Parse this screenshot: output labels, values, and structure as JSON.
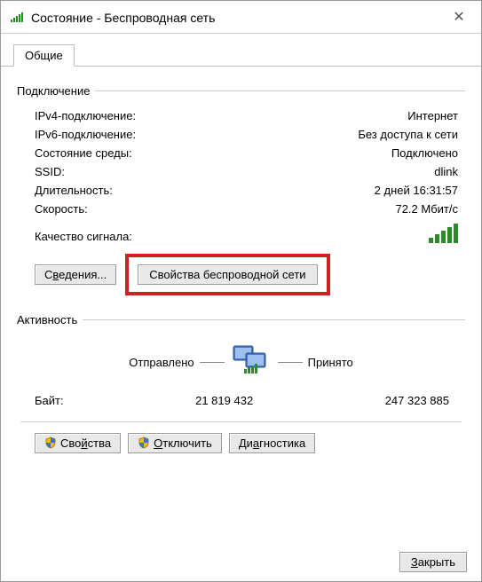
{
  "window": {
    "title": "Состояние - Беспроводная сеть"
  },
  "tabs": {
    "general": "Общие"
  },
  "connection": {
    "legend": "Подключение",
    "ipv4_label": "IPv4-подключение:",
    "ipv4_value": "Интернет",
    "ipv6_label": "IPv6-подключение:",
    "ipv6_value": "Без доступа к сети",
    "media_label": "Состояние среды:",
    "media_value": "Подключено",
    "ssid_label": "SSID:",
    "ssid_value": "dlink",
    "duration_label": "Длительность:",
    "duration_value": "2 дней 16:31:57",
    "speed_label": "Скорость:",
    "speed_value": "72.2 Мбит/с",
    "signal_label": "Качество сигнала:"
  },
  "buttons": {
    "details_pre": "С",
    "details_u": "в",
    "details_post": "едения...",
    "wifi_props": "Свойства беспроводной сети",
    "props_pre": "Сво",
    "props_u": "й",
    "props_post": "ства",
    "disconnect_pre": "",
    "disconnect_u": "О",
    "disconnect_post": "тключить",
    "diag_pre": "Ди",
    "diag_u": "а",
    "diag_post": "гностика",
    "close_pre": "",
    "close_u": "З",
    "close_post": "акрыть"
  },
  "activity": {
    "legend": "Активность",
    "sent": "Отправлено",
    "received": "Принято",
    "bytes_label": "Байт:",
    "bytes_sent": "21 819 432",
    "bytes_received": "247 323 885"
  }
}
